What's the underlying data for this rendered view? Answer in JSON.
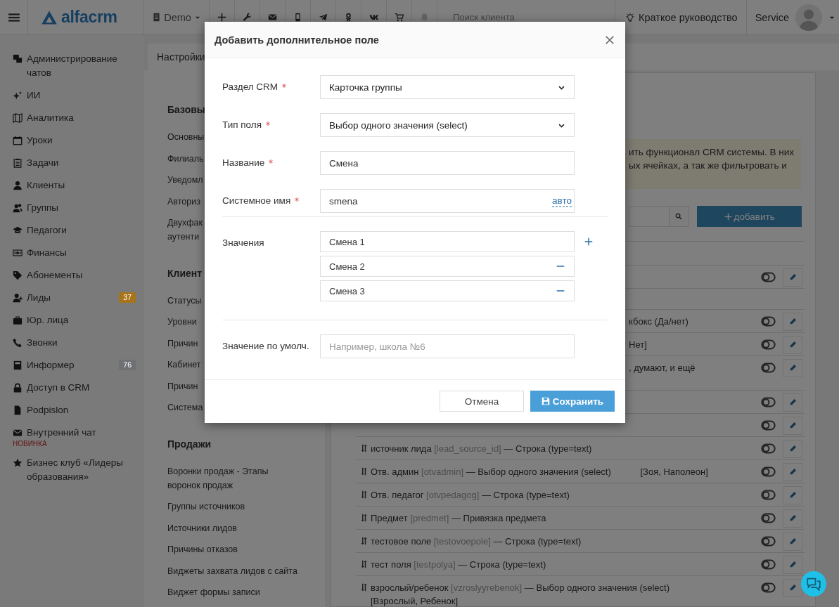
{
  "top_bar": {
    "logo": "alfacrm",
    "account": "Demo",
    "search": {
      "placeholder": "Поиск клиента"
    },
    "guide": "Краткое руководство",
    "user": "Service"
  },
  "sidebar": {
    "items": [
      {
        "label": "Администрирование чатов"
      },
      {
        "label": "ИИ"
      },
      {
        "label": "Аналитика"
      },
      {
        "label": "Уроки"
      },
      {
        "label": "Задачи"
      },
      {
        "label": "Клиенты"
      },
      {
        "label": "Группы"
      },
      {
        "label": "Педагоги"
      },
      {
        "label": "Финансы"
      },
      {
        "label": "Абонементы"
      },
      {
        "label": "Лиды",
        "badge": {
          "text": "37",
          "color": "#a8741a"
        }
      },
      {
        "label": "Юр. лица"
      },
      {
        "label": "Звонки"
      },
      {
        "label": "Информер",
        "badge": {
          "text": "76",
          "color": "#6e7073"
        }
      },
      {
        "label": "Доступ в CRM"
      },
      {
        "label": "Podpislon"
      },
      {
        "label": "Внутренний чат",
        "note": "НОВИНКА"
      },
      {
        "label": "Бизнес клуб «Лидеры образования»"
      }
    ]
  },
  "breadcrumb": "Настройки",
  "settings_menu": [
    {
      "title": "Базовы",
      "items": [
        "Основны",
        "Филиаль",
        "Уведомл",
        "Авториз",
        "Двухфак\nаутенти"
      ]
    },
    {
      "title": "Клиент",
      "items": [
        "Статусы",
        "Уровни",
        "Причин",
        "Кабинет",
        "Причин",
        "Система"
      ]
    },
    {
      "title": "Продажи",
      "items": [
        "Воронки продаж - Этапы\nворонок продаж",
        "Группы источников",
        "Источники лидов",
        "Причины отказов",
        "Виджеты захвата лидов с сайта",
        "Виджет формы записи"
      ]
    }
  ],
  "content": {
    "notice": [
      "ить функционал CRM системы. В них",
      "ых ячейках, а так же фильтровать и"
    ],
    "add_button": "добавить",
    "row_groups": [
      [
        {
          "kind": "cut",
          "on": false
        }
      ],
      [
        {
          "kind": "cut",
          "text": "кбокс (Да/нет)",
          "on": false
        },
        {
          "kind": "cut",
          "text": "Нет]",
          "on": false
        },
        {
          "kind": "cut_tall",
          "text": ", думают, и ещё",
          "on": false
        },
        {
          "kind": "cut",
          "on": false
        },
        {
          "kind": "cut",
          "on": false
        },
        {
          "kind": "full",
          "name": "источник лида",
          "system_name": "[lead_source_id]",
          "type": "— Строка (type=text)",
          "on": false
        },
        {
          "kind": "full",
          "name": "Отв. админ",
          "system_name": "[otvadmin]",
          "type": "— Выбор одного значения (select)",
          "values": "[Зоя, Наполеон]",
          "on": false
        },
        {
          "kind": "full",
          "name": "Отв. педагог",
          "system_name": "[otvpedagog]",
          "type": "— Строка (type=text)",
          "on": false
        },
        {
          "kind": "full",
          "name": "Предмет",
          "system_name": "[predmet]",
          "type": "— Привязка предмета",
          "on": false
        },
        {
          "kind": "full",
          "name": "тестовое поле",
          "system_name": "[testovoepole]",
          "type": "— Строка (type=text)",
          "on": false
        },
        {
          "kind": "full",
          "name": "тест поля",
          "system_name": "[testpolya]",
          "type": "— Строка (type=text)",
          "on": false
        },
        {
          "kind": "full",
          "name": "взрослый/ребенок",
          "system_name": "[vzroslyyrebenok]",
          "type": "— Выбор одного значения (select)",
          "values": "[Взрослый, Ребенок]",
          "values_wrap": true,
          "on": false
        }
      ]
    ]
  },
  "modal": {
    "title": "Добавить дополнительное поле",
    "fields": [
      {
        "kind": "select",
        "label": "Раздел CRM",
        "required": true,
        "value": "Карточка группы"
      },
      {
        "kind": "select",
        "label": "Тип поля",
        "required": true,
        "value": "Выбор одного значения (select)"
      },
      {
        "kind": "text",
        "label": "Название",
        "required": true,
        "value": "Смена"
      },
      {
        "kind": "text",
        "label": "Системное имя",
        "required": true,
        "value": "smena",
        "link": "авто"
      }
    ],
    "values": {
      "label": "Значения",
      "items": [
        {
          "value": "Смена 1",
          "kind": "add"
        },
        {
          "value": "Смена 2",
          "kind": "remove"
        },
        {
          "value": "Смена 3",
          "kind": "remove"
        }
      ]
    },
    "default": {
      "label": "Значение по умолч.",
      "placeholder": "Например, школа №6"
    },
    "buttons": [
      {
        "label": "Отмена",
        "kind": "secondary"
      },
      {
        "label": "Сохранить",
        "kind": "primary"
      }
    ]
  }
}
